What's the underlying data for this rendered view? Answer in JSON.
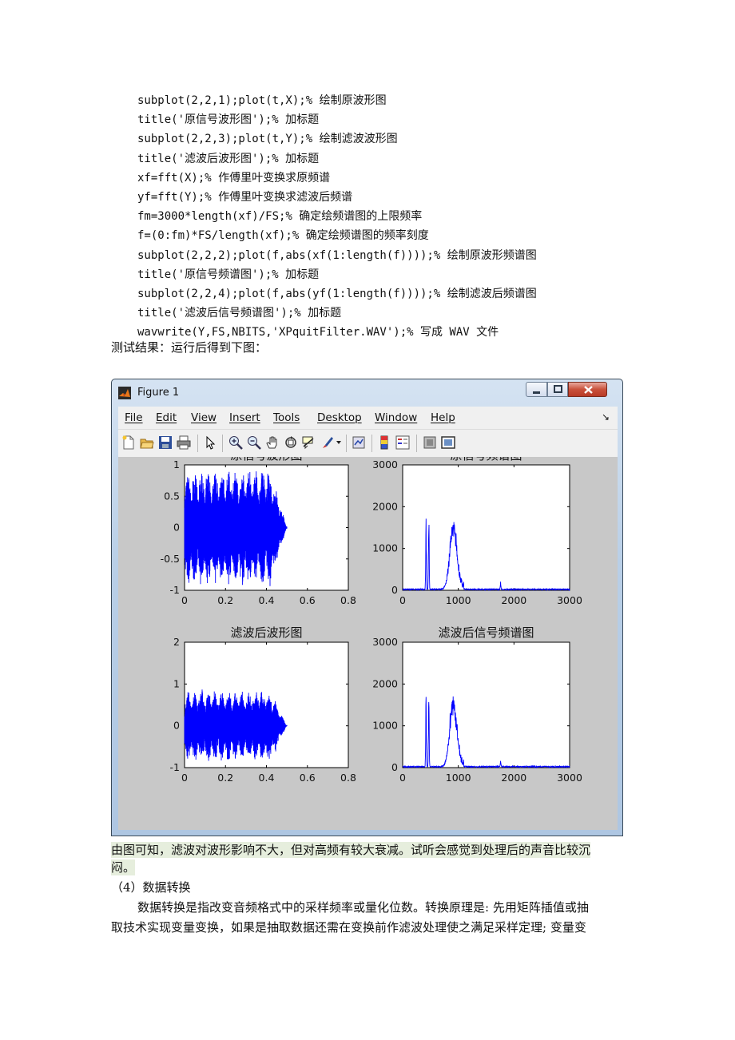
{
  "code_lines": [
    "subplot(2,2,1);plot(t,X);% 绘制原波形图",
    "title('原信号波形图');% 加标题",
    "subplot(2,2,3);plot(t,Y);% 绘制滤波波形图",
    "title('滤波后波形图');% 加标题",
    "xf=fft(X);% 作傅里叶变换求原频谱",
    "yf=fft(Y);% 作傅里叶变换求滤波后频谱",
    "fm=3000*length(xf)/FS;% 确定绘频谱图的上限频率",
    "f=(0:fm)*FS/length(xf);% 确定绘频谱图的频率刻度",
    "subplot(2,2,2);plot(f,abs(xf(1:length(f))));% 绘制原波形频谱图",
    "title('原信号频谱图');% 加标题",
    "subplot(2,2,4);plot(f,abs(yf(1:length(f))));% 绘制滤波后频谱图",
    "title('滤波后信号频谱图');% 加标题",
    "wavwrite(Y,FS,NBITS,'XPquitFilter.WAV');% 写成 WAV 文件"
  ],
  "result_label": "测试结果：运行后得到下图：",
  "figure_window": {
    "title": "Figure 1",
    "menus": [
      "File",
      "Edit",
      "View",
      "Insert",
      "Tools",
      "Desktop",
      "Window",
      "Help"
    ],
    "menu_arrow": "↘",
    "toolbar_icons": [
      "new-figure-icon",
      "open-file-icon",
      "save-figure-icon",
      "print-figure-icon",
      "edit-plot-icon",
      "zoom-in-icon",
      "zoom-out-icon",
      "pan-icon",
      "rotate-3d-icon",
      "data-cursor-icon",
      "brush-icon",
      "brush-dropdown-icon",
      "link-plot-icon",
      "colorbar-icon",
      "legend-icon",
      "hide-plot-tools-icon",
      "show-plot-tools-icon"
    ],
    "colors": {
      "line": "#0000ff",
      "canvas": "#c8c8c8",
      "axes_bg": "#ffffff"
    }
  },
  "chart_data": [
    {
      "type": "line",
      "title": "原信号波形图",
      "xlim": [
        0,
        0.8
      ],
      "ylim": [
        -1,
        1
      ],
      "xticks": [
        "0",
        "0.2",
        "0.4",
        "0.6",
        "0.8"
      ],
      "yticks": [
        "1",
        "0.5",
        "0",
        "-0.5",
        "-1"
      ],
      "series": [
        {
          "signal_extent_x": [
            0,
            0.5
          ],
          "envelope_max": 0.98,
          "decay_start": 0.42,
          "decay_end": 0.5
        }
      ]
    },
    {
      "type": "line",
      "title": "原信号频谱图",
      "xlim": [
        0,
        3000
      ],
      "ylim": [
        0,
        3000
      ],
      "xticks": [
        "0",
        "1000",
        "2000",
        "3000"
      ],
      "yticks": [
        "3000",
        "2000",
        "1000",
        "0"
      ],
      "series": [
        {
          "peaks": [
            {
              "x": 420,
              "y": 1770
            },
            {
              "x": 470,
              "y": 2230
            },
            {
              "x": 890,
              "y": 1030
            },
            {
              "x": 930,
              "y": 800
            },
            {
              "x": 1760,
              "y": 190
            }
          ]
        }
      ]
    },
    {
      "type": "line",
      "title": "滤波后波形图",
      "xlim": [
        0,
        0.8
      ],
      "ylim": [
        -1,
        2
      ],
      "xticks": [
        "0",
        "0.2",
        "0.4",
        "0.6",
        "0.8"
      ],
      "yticks": [
        "2",
        "1",
        "0",
        "-1"
      ],
      "series": [
        {
          "signal_extent_x": [
            0,
            0.5
          ],
          "envelope_max": 0.9,
          "decay_start": 0.42,
          "decay_end": 0.5
        }
      ]
    },
    {
      "type": "line",
      "title": "滤波后信号频谱图",
      "xlim": [
        0,
        3000
      ],
      "ylim": [
        0,
        3000
      ],
      "xticks": [
        "0",
        "1000",
        "2000",
        "3000"
      ],
      "yticks": [
        "3000",
        "2000",
        "1000",
        "0"
      ],
      "series": [
        {
          "peaks": [
            {
              "x": 420,
              "y": 1770
            },
            {
              "x": 470,
              "y": 2230
            },
            {
              "x": 890,
              "y": 1030
            },
            {
              "x": 930,
              "y": 800
            },
            {
              "x": 1760,
              "y": 190
            }
          ]
        }
      ]
    }
  ],
  "conclusion": [
    "由图可知，滤波对波形影响不大，但对高频有较大衰减。试听会感觉到处理后的声音比较沉",
    "闷。"
  ],
  "section_heading": "（4）数据转换",
  "body_text": [
    "数据转换是指改变音频格式中的采样频率或量化位数。转换原理是: 先用矩阵插值或抽",
    "取技术实现变量变换，如果是抽取数据还需在变换前作滤波处理使之满足采样定理; 变量变"
  ]
}
